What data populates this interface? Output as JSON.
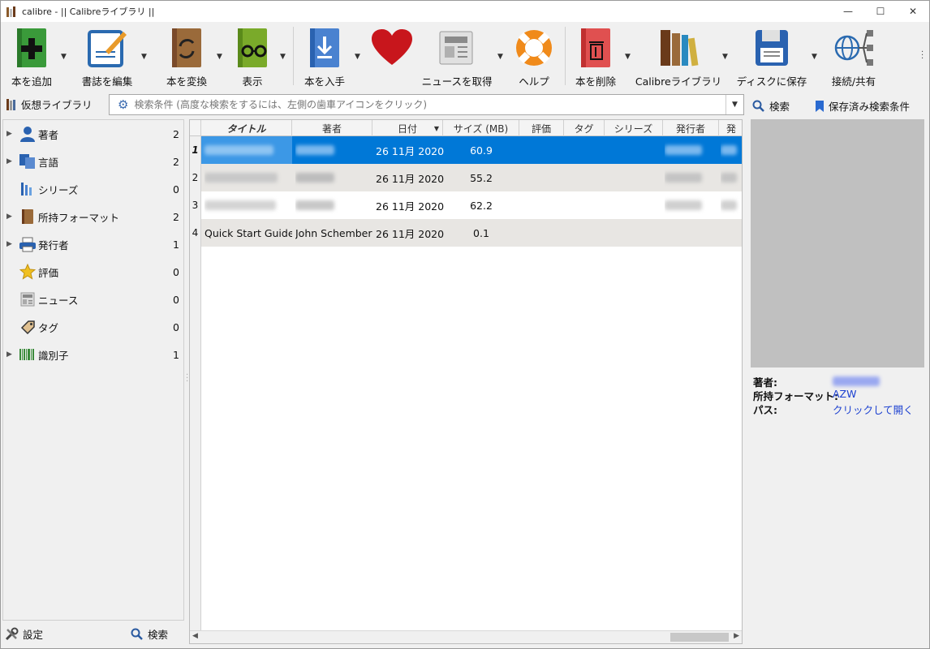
{
  "window": {
    "title": "calibre - || Calibreライブラリ ||",
    "minimize": "—",
    "maximize": "☐",
    "close": "✕"
  },
  "toolbar": {
    "add": "本を追加",
    "edit_meta": "書誌を編集",
    "convert": "本を変換",
    "view": "表示",
    "get_books": "本を入手",
    "fetch_news": "ニュースを取得",
    "help": "ヘルプ",
    "remove": "本を削除",
    "library": "Calibreライブラリ",
    "save": "ディスクに保存",
    "connect": "接続/共有"
  },
  "search": {
    "virtual_library": "仮想ライブラリ",
    "placeholder": "検索条件 (高度な検索をするには、左側の歯車アイコンをクリック)",
    "search_btn": "検索",
    "saved_searches": "保存済み検索条件"
  },
  "tag_browser": {
    "items": [
      {
        "name": "著者",
        "count": "2"
      },
      {
        "name": "言語",
        "count": "2"
      },
      {
        "name": "シリーズ",
        "count": "0"
      },
      {
        "name": "所持フォーマット",
        "count": "2"
      },
      {
        "name": "発行者",
        "count": "1"
      },
      {
        "name": "評価",
        "count": "0"
      },
      {
        "name": "ニュース",
        "count": "0"
      },
      {
        "name": "タグ",
        "count": "0"
      },
      {
        "name": "識別子",
        "count": "1"
      }
    ],
    "settings": "設定",
    "find": "検索"
  },
  "book_table": {
    "columns": [
      "タイトル",
      "著者",
      "日付",
      "サイズ (MB)",
      "評価",
      "タグ",
      "シリーズ",
      "発行者",
      "発"
    ],
    "rows": [
      {
        "num": "1",
        "title": "",
        "author": "",
        "date": "26 11月 2020",
        "size": "60.9"
      },
      {
        "num": "2",
        "title": "",
        "author": "",
        "date": "26 11月 2020",
        "size": "55.2"
      },
      {
        "num": "3",
        "title": "",
        "author": "",
        "date": "26 11月 2020",
        "size": "62.2"
      },
      {
        "num": "4",
        "title": "Quick Start Guide",
        "author": "John Schember",
        "date": "26 11月 2020",
        "size": "0.1"
      }
    ]
  },
  "details": {
    "author_label": "著者:",
    "formats_label": "所持フォーマット:",
    "formats_value": "AZW",
    "path_label": "パス:",
    "path_value": "クリックして開く"
  },
  "colors": {
    "selection": "#0078d7",
    "link": "#1a3fd0",
    "alt_row": "#e8e6e3"
  }
}
